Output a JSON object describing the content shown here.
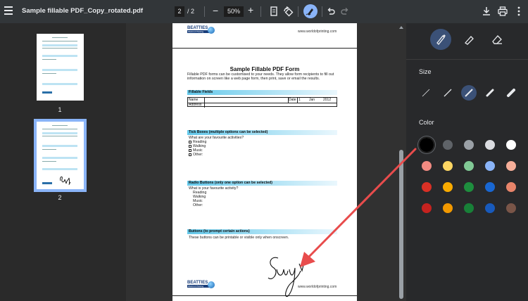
{
  "toolbar": {
    "title": "Sample fillable PDF_Copy_rotated.pdf",
    "current_page": "2",
    "page_separator": "/",
    "total_pages": "2",
    "zoom": "50%",
    "minus": "−",
    "plus": "+"
  },
  "thumbnails": [
    {
      "label": "1",
      "selected": false
    },
    {
      "label": "2",
      "selected": true
    }
  ],
  "pdf_page": {
    "logo_text": "BEATTIES",
    "logo_subtext": "World of Printing",
    "url": "www.worldofprinting.com",
    "title": "Sample Fillable PDF Form",
    "intro": "Fillable PDF forms can be customised to your needs. They allow form recipients to fill out information on screen like a web page form, then print, save or email the results.",
    "sections": {
      "fillable": "Fillable Fields",
      "tick": "Tick Boxes (multiple options can be selected)",
      "radio": "Radio Buttons (only one option can be selected)",
      "buttons": "Buttons (to prompt certain actions)"
    },
    "fields": {
      "name": "Name",
      "address": "Address",
      "date": "Date",
      "day": "1",
      "month": "Jan",
      "year": "2012"
    },
    "tick_question": "What are your favourite activities?",
    "tick_options": [
      "Reading",
      "Walking",
      "Music",
      "Other:"
    ],
    "radio_question": "What is your favourite activity?",
    "radio_options": [
      "Reading",
      "Walking",
      "Music",
      "Other:"
    ],
    "buttons_text": "These buttons can be printable or visible only when onscreen."
  },
  "panel": {
    "tools": [
      "pen-tool",
      "highlighter-tool",
      "eraser-tool"
    ],
    "active_tool": "pen-tool",
    "size_label": "Size",
    "selected_size_index": 2,
    "color_label": "Color",
    "colors": [
      [
        "#000000",
        "#5f6368",
        "#9aa0a6",
        "#dadce0",
        "#ffffff"
      ],
      [
        "#f28b82",
        "#fdd663",
        "#81c995",
        "#8ab4f8",
        "#f6ae99"
      ],
      [
        "#d93025",
        "#f9ab00",
        "#1e8e3e",
        "#1967d2",
        "#e8846a"
      ],
      [
        "#c5221f",
        "#f29900",
        "#188038",
        "#185abc",
        "#795548"
      ]
    ],
    "selected_color": "#000000"
  },
  "accent": "#8ab4f8",
  "arrow_color": "#e84c4c"
}
